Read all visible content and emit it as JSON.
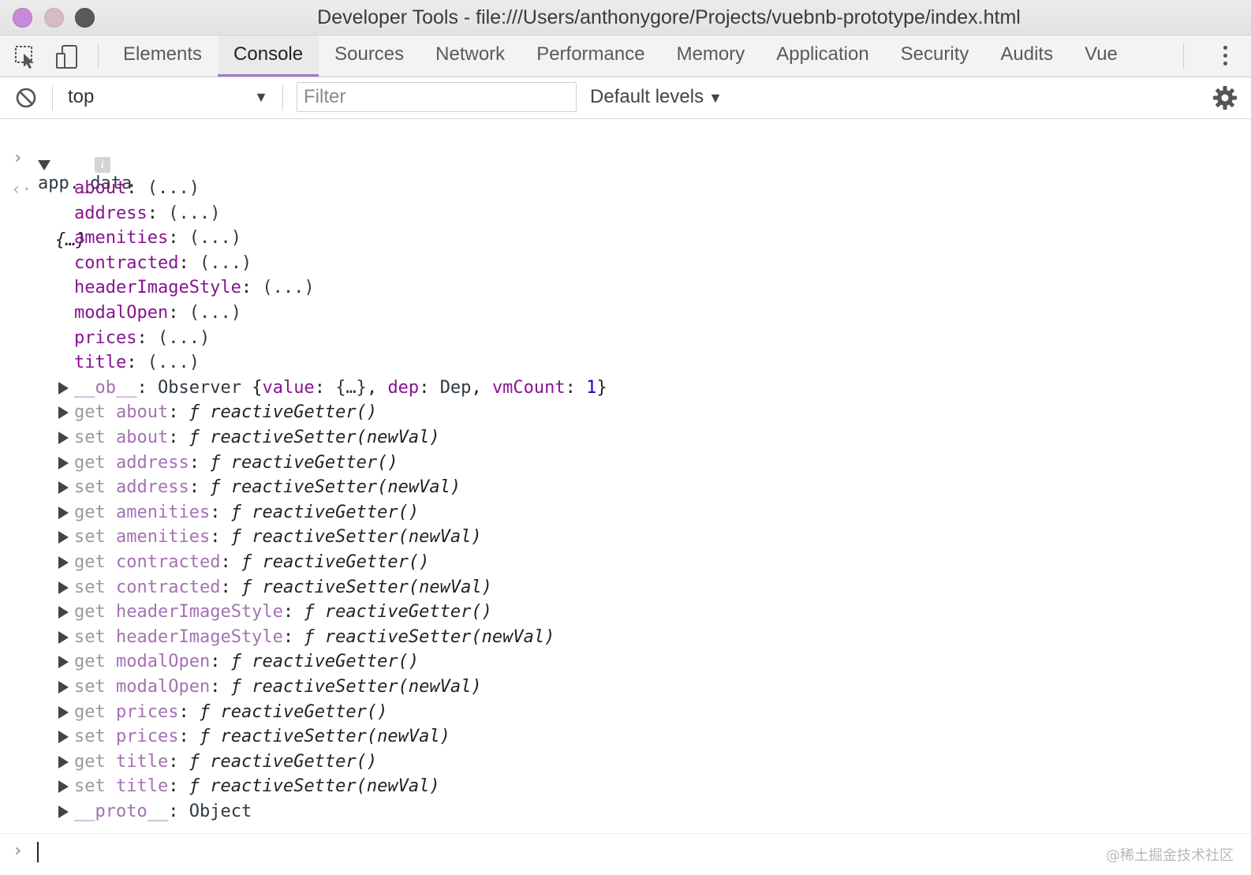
{
  "window": {
    "title": "Developer Tools - file:///Users/anthonygore/Projects/vuebnb-prototype/index.html"
  },
  "tabs": [
    {
      "label": "Elements",
      "active": false
    },
    {
      "label": "Console",
      "active": true
    },
    {
      "label": "Sources",
      "active": false
    },
    {
      "label": "Network",
      "active": false
    },
    {
      "label": "Performance",
      "active": false
    },
    {
      "label": "Memory",
      "active": false
    },
    {
      "label": "Application",
      "active": false
    },
    {
      "label": "Security",
      "active": false
    },
    {
      "label": "Audits",
      "active": false
    },
    {
      "label": "Vue",
      "active": false
    }
  ],
  "toolbar": {
    "context": "top",
    "filter_placeholder": "Filter",
    "filter_value": "",
    "levels": "Default levels"
  },
  "console": {
    "command": "app._data",
    "result_summary": "{…}",
    "info_badge": "i",
    "data_props": [
      {
        "key": "about",
        "value": "(...)"
      },
      {
        "key": "address",
        "value": "(...)"
      },
      {
        "key": "amenities",
        "value": "(...)"
      },
      {
        "key": "contracted",
        "value": "(...)"
      },
      {
        "key": "headerImageStyle",
        "value": "(...)"
      },
      {
        "key": "modalOpen",
        "value": "(...)"
      },
      {
        "key": "prices",
        "value": "(...)"
      },
      {
        "key": "title",
        "value": "(...)"
      }
    ],
    "observer": {
      "key": "__ob__",
      "type": "Observer",
      "open": "{",
      "k1": "value",
      "v1": "{…}",
      "k2": "dep",
      "v2": "Dep",
      "k3": "vmCount",
      "v3": "1",
      "close": "}"
    },
    "accessors": [
      {
        "kind": "get",
        "key": "about",
        "fn": "reactiveGetter()"
      },
      {
        "kind": "set",
        "key": "about",
        "fn": "reactiveSetter(newVal)"
      },
      {
        "kind": "get",
        "key": "address",
        "fn": "reactiveGetter()"
      },
      {
        "kind": "set",
        "key": "address",
        "fn": "reactiveSetter(newVal)"
      },
      {
        "kind": "get",
        "key": "amenities",
        "fn": "reactiveGetter()"
      },
      {
        "kind": "set",
        "key": "amenities",
        "fn": "reactiveSetter(newVal)"
      },
      {
        "kind": "get",
        "key": "contracted",
        "fn": "reactiveGetter()"
      },
      {
        "kind": "set",
        "key": "contracted",
        "fn": "reactiveSetter(newVal)"
      },
      {
        "kind": "get",
        "key": "headerImageStyle",
        "fn": "reactiveGetter()"
      },
      {
        "kind": "set",
        "key": "headerImageStyle",
        "fn": "reactiveSetter(newVal)"
      },
      {
        "kind": "get",
        "key": "modalOpen",
        "fn": "reactiveGetter()"
      },
      {
        "kind": "set",
        "key": "modalOpen",
        "fn": "reactiveSetter(newVal)"
      },
      {
        "kind": "get",
        "key": "prices",
        "fn": "reactiveGetter()"
      },
      {
        "kind": "set",
        "key": "prices",
        "fn": "reactiveSetter(newVal)"
      },
      {
        "kind": "get",
        "key": "title",
        "fn": "reactiveGetter()"
      },
      {
        "kind": "set",
        "key": "title",
        "fn": "reactiveSetter(newVal)"
      }
    ],
    "fn_glyph": "ƒ",
    "proto": {
      "key": "__proto__",
      "value": "Object"
    }
  },
  "watermark": "@稀土掘金技术社区",
  "colors": {
    "accent": "#a57bc4",
    "key": "#881391",
    "number": "#1c00cf"
  }
}
